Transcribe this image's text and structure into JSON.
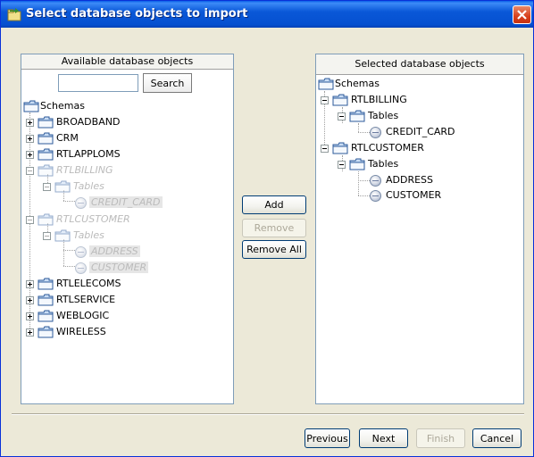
{
  "window": {
    "title": "Select database objects to import"
  },
  "left_panel": {
    "header": "Available database objects",
    "search_value": "",
    "search_button": "Search",
    "tree": {
      "root": "Schemas",
      "items": [
        {
          "label": "BROADBAND"
        },
        {
          "label": "CRM"
        },
        {
          "label": "RTLAPPLOMS"
        },
        {
          "label": "RTLBILLING",
          "tables": "Tables",
          "cols": [
            "CREDIT_CARD"
          ]
        },
        {
          "label": "RTLCUSTOMER",
          "tables": "Tables",
          "cols": [
            "ADDRESS",
            "CUSTOMER"
          ]
        },
        {
          "label": "RTLELECOMS"
        },
        {
          "label": "RTLSERVICE"
        },
        {
          "label": "WEBLOGIC"
        },
        {
          "label": "WIRELESS"
        }
      ]
    }
  },
  "middle_buttons": {
    "add": "Add",
    "remove": "Remove",
    "remove_all": "Remove All"
  },
  "right_panel": {
    "header": "Selected database objects",
    "tree": {
      "root": "Schemas",
      "items": [
        {
          "label": "RTLBILLING",
          "tables": "Tables",
          "cols": [
            "CREDIT_CARD"
          ]
        },
        {
          "label": "RTLCUSTOMER",
          "tables": "Tables",
          "cols": [
            "ADDRESS",
            "CUSTOMER"
          ]
        }
      ]
    }
  },
  "footer": {
    "previous": "Previous",
    "next": "Next",
    "finish": "Finish",
    "cancel": "Cancel"
  }
}
